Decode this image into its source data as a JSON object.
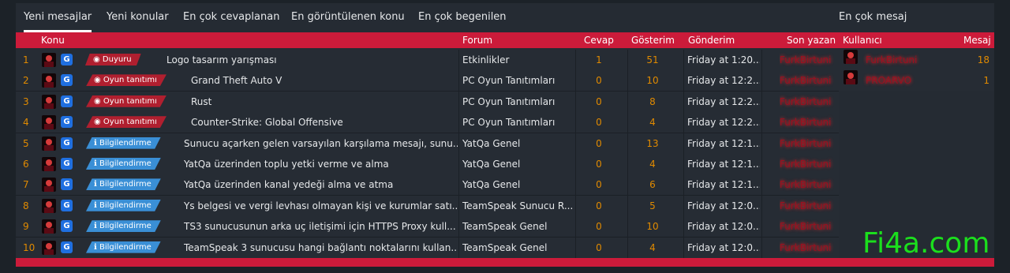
{
  "tabs": [
    "Yeni mesajlar",
    "Yeni konular",
    "En çok cevaplanan",
    "En görüntülenen konu",
    "En çok begenilen"
  ],
  "side_tab": "En çok mesaj",
  "headers": {
    "konu": "Konu",
    "forum": "Forum",
    "cevap": "Cevap",
    "gosterim": "Gösterim",
    "gonderim": "Gönderim",
    "son_yazan": "Son yazan",
    "kullanici": "Kullanıcı",
    "mesaj": "Mesaj"
  },
  "rows": [
    {
      "n": "1",
      "badge": "Duyuru",
      "badge_icon": "megaphone-icon",
      "badge_color": "red",
      "title": "Logo tasarım yarışması",
      "forum": "Etkinlikler",
      "cevap": "1",
      "gosterim": "51",
      "date": "Friday at 1:20...",
      "user": "FurkBirtuni"
    },
    {
      "n": "2",
      "badge": "Oyun tanıtımı",
      "badge_icon": "gamepad-icon",
      "badge_color": "red",
      "title": "Grand Theft Auto V",
      "forum": "PC Oyun Tanıtımları",
      "cevap": "0",
      "gosterim": "10",
      "date": "Friday at 12:2...",
      "user": "FurkBirtuni"
    },
    {
      "n": "3",
      "badge": "Oyun tanıtımı",
      "badge_icon": "gamepad-icon",
      "badge_color": "red",
      "title": "Rust",
      "forum": "PC Oyun Tanıtımları",
      "cevap": "0",
      "gosterim": "8",
      "date": "Friday at 12:2...",
      "user": "FurkBirtuni"
    },
    {
      "n": "4",
      "badge": "Oyun tanıtımı",
      "badge_icon": "gamepad-icon",
      "badge_color": "red",
      "title": "Counter-Strike: Global Offensive",
      "forum": "PC Oyun Tanıtımları",
      "cevap": "0",
      "gosterim": "4",
      "date": "Friday at 12:2...",
      "user": "FurkBirtuni"
    },
    {
      "n": "5",
      "badge": "Bilgilendirme",
      "badge_icon": "info-icon",
      "badge_color": "blue",
      "title": "Sunucu açarken gelen varsayılan karşılama mesajı, sunu...",
      "forum": "YatQa Genel",
      "cevap": "0",
      "gosterim": "13",
      "date": "Friday at 12:1...",
      "user": "FurkBirtuni"
    },
    {
      "n": "6",
      "badge": "Bilgilendirme",
      "badge_icon": "info-icon",
      "badge_color": "blue",
      "title": "YatQa üzerinden toplu yetki verme ve alma",
      "forum": "YatQa Genel",
      "cevap": "0",
      "gosterim": "4",
      "date": "Friday at 12:1...",
      "user": "FurkBirtuni"
    },
    {
      "n": "7",
      "badge": "Bilgilendirme",
      "badge_icon": "info-icon",
      "badge_color": "blue",
      "title": "YatQa üzerinden kanal yedeği alma ve atma",
      "forum": "YatQa Genel",
      "cevap": "0",
      "gosterim": "6",
      "date": "Friday at 12:1...",
      "user": "FurkBirtuni"
    },
    {
      "n": "8",
      "badge": "Bilgilendirme",
      "badge_icon": "info-icon",
      "badge_color": "blue",
      "title": "Ys belgesi ve vergi levhası olmayan kişi ve kurumlar satı...",
      "forum": "TeamSpeak Sunucu R...",
      "cevap": "0",
      "gosterim": "5",
      "date": "Friday at 12:0...",
      "user": "FurkBirtuni"
    },
    {
      "n": "9",
      "badge": "Bilgilendirme",
      "badge_icon": "info-icon",
      "badge_color": "blue",
      "title": "TS3 sunucusunun arka uç iletişimi için HTTPS Proxy kull...",
      "forum": "TeamSpeak Genel",
      "cevap": "0",
      "gosterim": "10",
      "date": "Friday at 12:0...",
      "user": "FurkBirtuni"
    },
    {
      "n": "10",
      "badge": "Bilgilendirme",
      "badge_icon": "info-icon",
      "badge_color": "blue",
      "title": "TeamSpeak 3 sunucusu hangi bağlantı noktalarını kullan...",
      "forum": "TeamSpeak Genel",
      "cevap": "0",
      "gosterim": "4",
      "date": "Friday at 12:0...",
      "user": "FurkBirtuni"
    }
  ],
  "side_rows": [
    {
      "user": "FurkBirtuni",
      "count": "18"
    },
    {
      "user": "PROARVO",
      "count": "1"
    }
  ],
  "watermark": "Fi4a.com",
  "colors": {
    "accent": "#cc1b3a",
    "number": "#e08a00",
    "badge_red": "#b01f2f",
    "badge_blue": "#3a8fd6",
    "username": "#9b0f1f"
  }
}
